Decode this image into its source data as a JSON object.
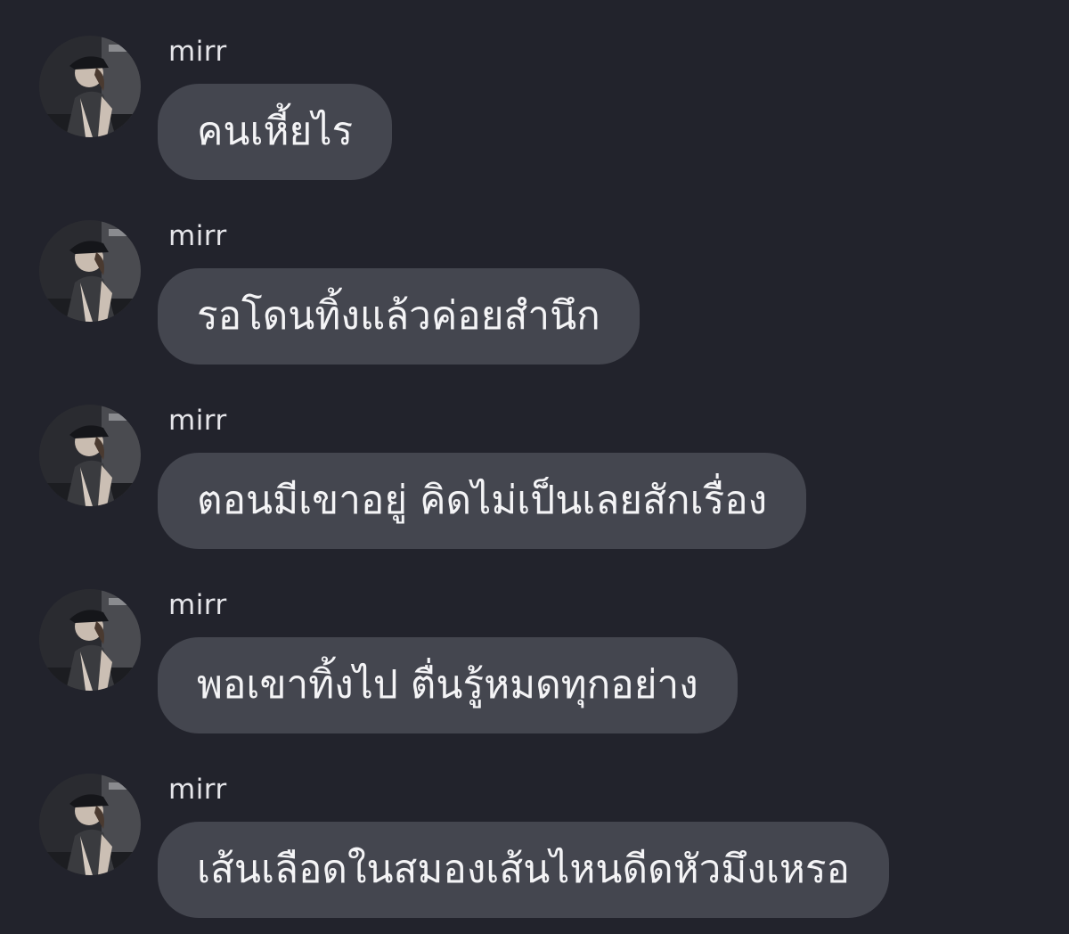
{
  "conversation": {
    "messages": [
      {
        "sender": "mirr",
        "avatar_icon": "profile-photo-avatar",
        "text": "คนเหี้ยไร"
      },
      {
        "sender": "mirr",
        "avatar_icon": "profile-photo-avatar",
        "text": "รอโดนทิ้งแล้วค่อยสำนึก"
      },
      {
        "sender": "mirr",
        "avatar_icon": "profile-photo-avatar",
        "text": "ตอนมีเขาอยู่ คิดไม่เป็นเลยสักเรื่อง"
      },
      {
        "sender": "mirr",
        "avatar_icon": "profile-photo-avatar",
        "text": "พอเขาทิ้งไป ตื่นรู้หมดทุกอย่าง"
      },
      {
        "sender": "mirr",
        "avatar_icon": "profile-photo-avatar",
        "text": "เส้นเลือดในสมองเส้นไหนดีดหัวมึงเหรอ"
      }
    ]
  },
  "colors": {
    "background": "#22232c",
    "bubble": "#44464f",
    "text": "#f4f4f6"
  }
}
